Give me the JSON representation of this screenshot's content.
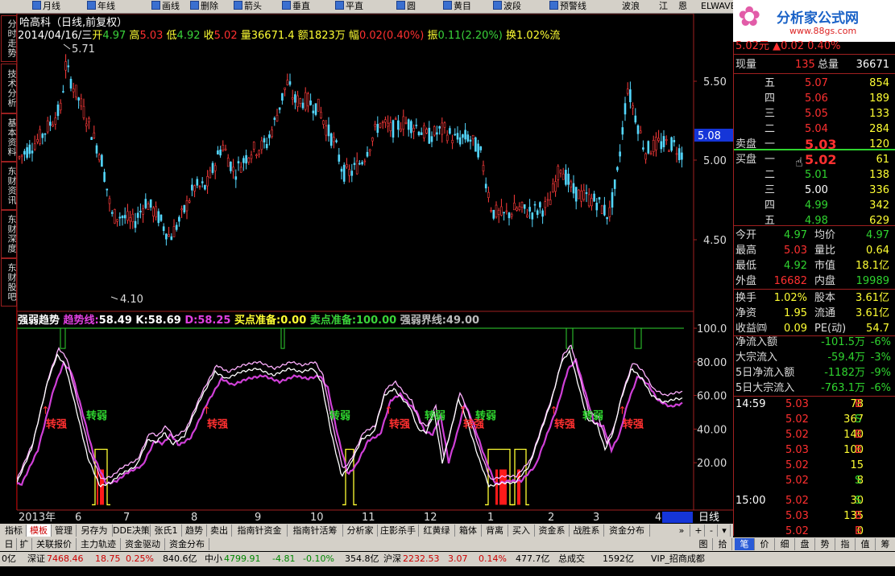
{
  "toolbar": {
    "items": [
      "月线",
      "年线",
      "画线",
      "删除",
      "箭头",
      "垂直",
      "平直",
      "圆",
      "黄目",
      "波段",
      "预警线",
      "波浪",
      "江",
      "恩",
      "ELWAVE"
    ]
  },
  "logo": {
    "title": "分析家公式网",
    "url": "www.88gs.com"
  },
  "vtabs": [
    "分时走势",
    "技术分析",
    "基本资料",
    "东财资讯",
    "东财深度",
    "东财股吧"
  ],
  "header": {
    "stock": "哈高科（日线,前复权）",
    "date": "2014/04/16/三",
    "open_l": "开",
    "open": "4.97",
    "high_l": "高",
    "high": "5.03",
    "low_l": "低",
    "low": "4.92",
    "close_l": "收",
    "close": "5.02",
    "vol_l": "量",
    "vol": "36671.4",
    "amt_l": "额",
    "amt": "1823万",
    "chg_l": "幅",
    "chg": "0.02(0.40%)",
    "amp_l": "振",
    "amp": "0.11(2.20%)",
    "turn_l": "换",
    "turn": "1.02%",
    "tail": "流"
  },
  "price_axis": {
    "labels": [
      "5.50",
      "5.00",
      "4.50"
    ],
    "current": "5.08",
    "max_mark": "5.71",
    "min_mark": "4.10"
  },
  "indicator": {
    "name": "强弱趋势",
    "trend_l": "趋势线:",
    "trend": "58.49",
    "k_l": "K:",
    "k": "58.69",
    "d_l": "D:",
    "d": "58.25",
    "buy_l": "买点准备:",
    "buy": "0.00",
    "sell_l": "卖点准备:",
    "sell": "100.00",
    "bound_l": "强弱界线:",
    "bound": "49.00",
    "axis": [
      "100.0",
      "80.00",
      "60.00",
      "40.00",
      "20.00"
    ],
    "strong": "转强",
    "weak": "转弱"
  },
  "date_axis": {
    "labels": [
      "2013年",
      "6",
      "7",
      "8",
      "9",
      "10",
      "11",
      "12",
      "1",
      "2",
      "3",
      "4"
    ],
    "period": "日线"
  },
  "quote": {
    "top_partial": "5.02元  ▲0.02  0.40%",
    "now_l": "现量",
    "now": "135",
    "total_l": "总量",
    "total": "36671",
    "sell_label": "卖盘",
    "buy_label": "买盘",
    "asks": [
      {
        "lvl": "五",
        "price": "5.07",
        "vol": "854"
      },
      {
        "lvl": "四",
        "price": "5.06",
        "vol": "189"
      },
      {
        "lvl": "三",
        "price": "5.05",
        "vol": "133"
      },
      {
        "lvl": "二",
        "price": "5.04",
        "vol": "284"
      },
      {
        "lvl": "一",
        "price": "5.03",
        "vol": "120"
      }
    ],
    "bids": [
      {
        "lvl": "一",
        "price": "5.02",
        "vol": "61"
      },
      {
        "lvl": "二",
        "price": "5.01",
        "vol": "138"
      },
      {
        "lvl": "三",
        "price": "5.00",
        "vol": "336"
      },
      {
        "lvl": "四",
        "price": "4.99",
        "vol": "342"
      },
      {
        "lvl": "五",
        "price": "4.98",
        "vol": "629"
      }
    ],
    "stats": [
      [
        "今开",
        "4.97",
        "均价",
        "4.97"
      ],
      [
        "最高",
        "5.03",
        "量比",
        "0.64"
      ],
      [
        "最低",
        "4.92",
        "市值",
        "18.1亿"
      ],
      [
        "外盘",
        "16682",
        "内盘",
        "19989"
      ]
    ],
    "stats2": [
      [
        "换手",
        "1.02%",
        "股本",
        "3.61亿"
      ],
      [
        "净资",
        "1.95",
        "流通",
        "3.61亿"
      ],
      [
        "收益㈣",
        "0.09",
        "PE(动)",
        "54.7"
      ]
    ],
    "flows": [
      [
        "净流入额",
        "-101.5万",
        "-6%"
      ],
      [
        "大宗流入",
        "-59.4万",
        "-3%"
      ],
      [
        "5日净流入额",
        "-1182万",
        "-9%"
      ],
      [
        "5日大宗流入",
        "-763.1万",
        "-6%"
      ]
    ],
    "ticks": [
      [
        "14:59",
        "5.03",
        "78",
        "B"
      ],
      [
        "",
        "5.02",
        "367",
        "S"
      ],
      [
        "",
        "5.02",
        "140",
        "B"
      ],
      [
        "",
        "5.03",
        "100",
        "B"
      ],
      [
        "",
        "5.02",
        "15",
        ""
      ],
      [
        "",
        "5.02",
        "8",
        "S"
      ],
      [
        "15:00",
        "5.02",
        "30",
        "S"
      ],
      [
        "",
        "5.03",
        "135",
        "B"
      ],
      [
        "",
        "5.02",
        "0",
        "B"
      ]
    ]
  },
  "bottom_tabs": [
    "指标",
    "模板",
    "管理",
    "另存为",
    "DDE决策",
    "张氏1",
    "趋势",
    "卖出",
    "指南针资金",
    "指南针活筹",
    "分析家",
    "庄影杀手",
    "红黄绿",
    "箱体",
    "背离",
    "买入",
    "资金系",
    "战胜系",
    "资金分布"
  ],
  "bottom_tabs2": [
    "日",
    "扩",
    "关联报价",
    "主力轨迹",
    "资金驱动",
    "资金分布"
  ],
  "right_tabs": [
    "笔",
    "价",
    "细",
    "盘",
    "势",
    "指",
    "值",
    "筹"
  ],
  "right_tabs_top": [
    "图",
    "拾"
  ],
  "status": {
    "s0": "0亿",
    "sz_l": "深证",
    "sz": "7468.46",
    "sz_chg": "18.75",
    "sz_pct": "0.25%",
    "sz_amt": "840.6亿",
    "zx_l": "中小",
    "zx": "4799.91",
    "zx_chg": "-4.81",
    "zx_pct": "-0.10%",
    "zx_amt": "354.8亿",
    "hs_l": "沪深",
    "hs": "2232.53",
    "hs_chg": "3.07",
    "hs_pct": "0.14%",
    "hs_amt": "477.7亿",
    "total_l": "总成交",
    "total": "1592亿",
    "vip": "VIP_招商成都"
  }
}
